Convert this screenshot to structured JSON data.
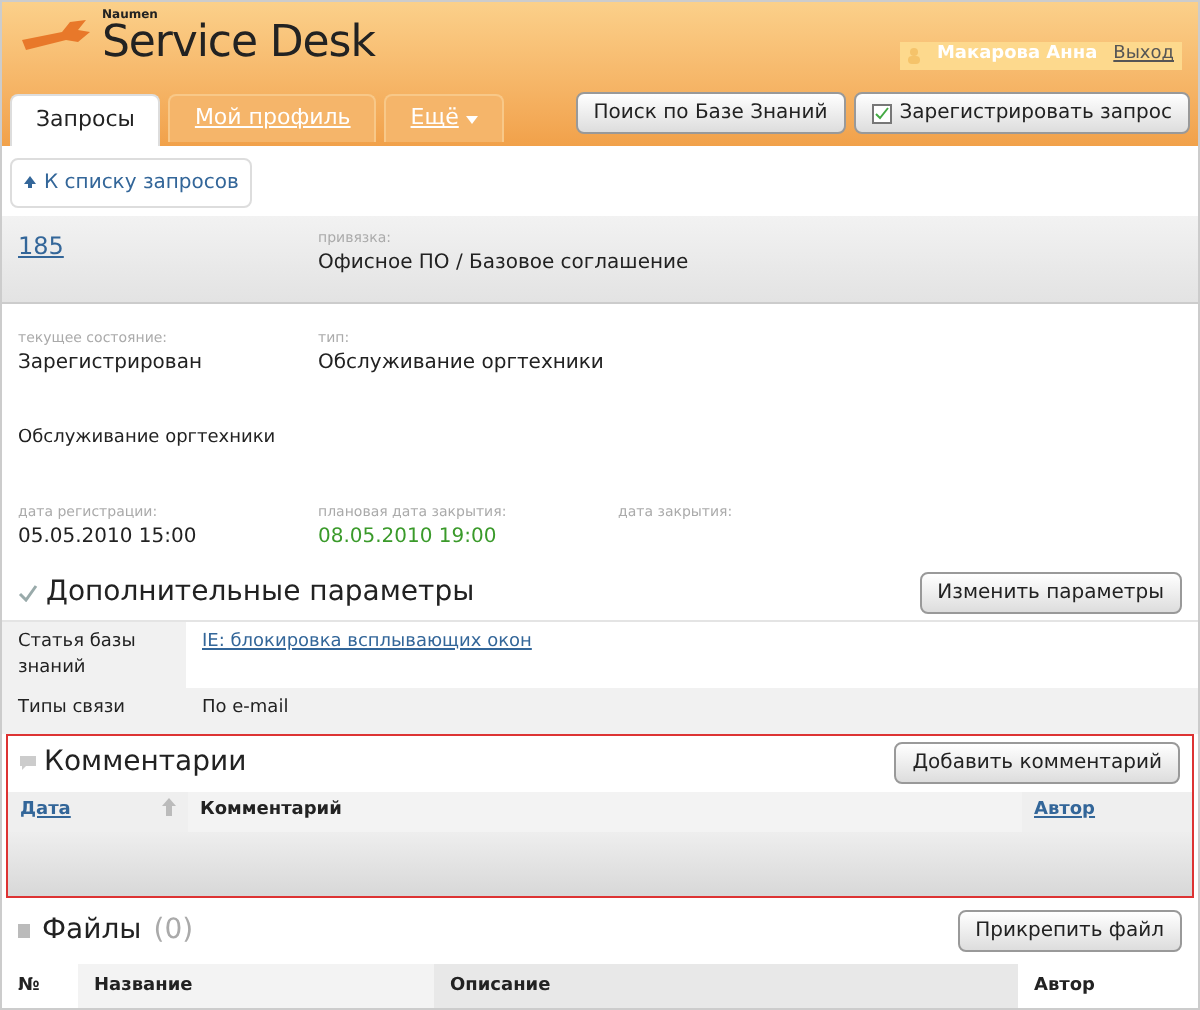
{
  "header": {
    "brand_small": "Naumen",
    "brand": "Service Desk",
    "user": "Макарова Анна",
    "logout": "Выход"
  },
  "tabs": [
    {
      "label": "Запросы",
      "selected": true,
      "dropdown": false
    },
    {
      "label": "Мой профиль",
      "selected": false,
      "dropdown": false
    },
    {
      "label": "Ещё",
      "selected": false,
      "dropdown": true
    }
  ],
  "header_buttons": [
    {
      "label": "Поиск по Базе Знаний",
      "kind": "plain"
    },
    {
      "label": "Зарегистрировать запрос",
      "kind": "icon"
    }
  ],
  "back_link": "К списку запросов",
  "request": {
    "number": "185",
    "binding_label": "привязка:",
    "binding": "Офисное ПО / Базовое соглашение"
  },
  "fields": [
    {
      "label": "текущее состояние:",
      "value": "Зарегистрирован"
    },
    {
      "label": "тип:",
      "value": "Обслуживание оргтехники"
    }
  ],
  "description": "Обслуживание оргтехники",
  "dates": [
    {
      "label": "дата регистрации:",
      "value": "05.05.2010 15:00",
      "color": "#222222"
    },
    {
      "label": "плановая дата закрытия:",
      "value": "08.05.2010 19:00",
      "color": "#3a9a2a"
    },
    {
      "label": "дата закрытия:"
    }
  ],
  "params": {
    "title": "Дополнительные параметры",
    "button": "Изменить параметры",
    "rows": [
      {
        "name": "Статья базы знаний",
        "value": "IE: блокировка всплывающих окон",
        "kind": "link"
      },
      {
        "name": "Типы связи",
        "value": "По e-mail",
        "kind": "text"
      }
    ]
  },
  "comments": {
    "title": "Комментарии",
    "button": "Добавить комментарий",
    "columns": [
      {
        "label": "Дата",
        "kind": "link"
      },
      {
        "label": "Комментарий",
        "kind": "bold"
      },
      {
        "label": "Автор",
        "kind": "link"
      }
    ]
  },
  "files": {
    "title": "Файлы",
    "count": "(0)",
    "button": "Прикрепить файл",
    "columns": [
      "№",
      "Название",
      "Описание",
      "Автор"
    ]
  }
}
